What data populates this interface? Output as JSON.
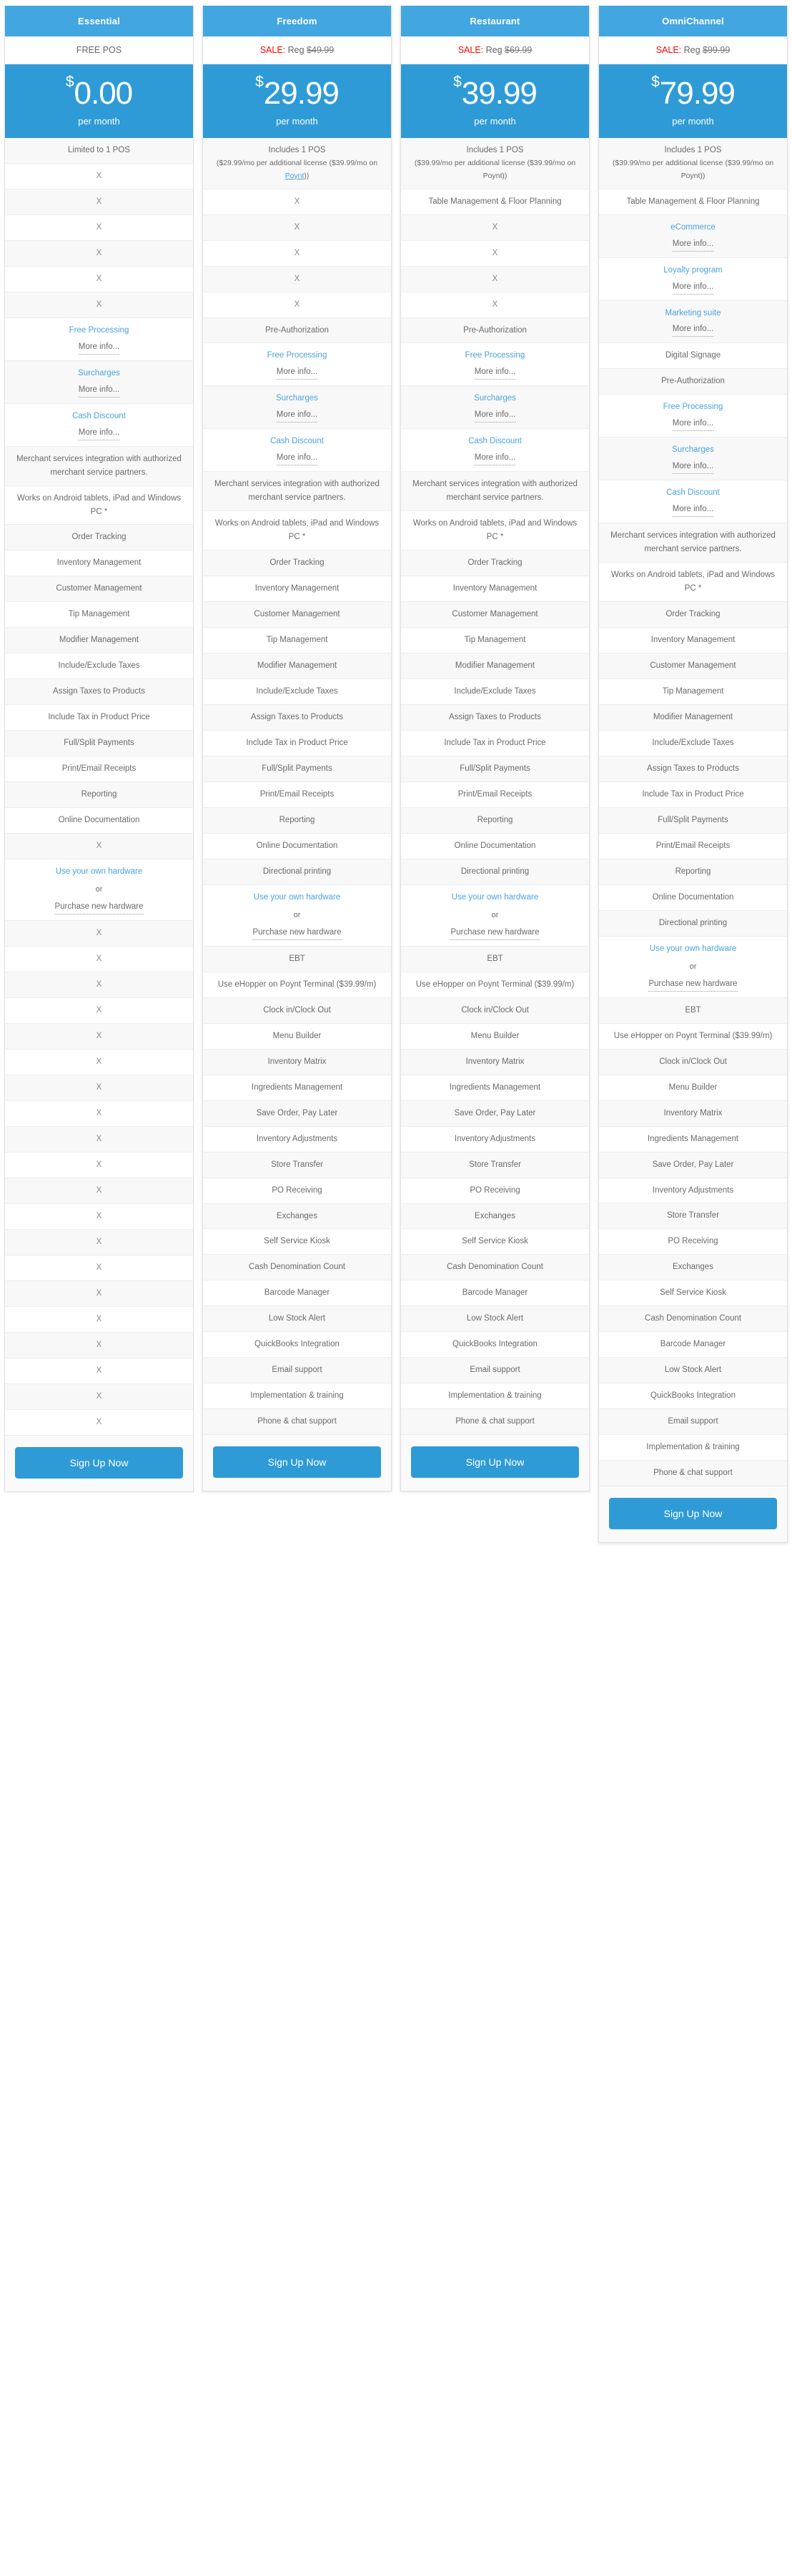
{
  "meta": {
    "accent_blue": "#2e9bd6",
    "header_blue": "#42a7e0",
    "link_blue": "#4aa3e0",
    "sale_red": "#ff0000",
    "text_gray": "#6b6b6b",
    "alt_row_bg": "#f8f8f8"
  },
  "labels": {
    "per_month": "per month",
    "more_info": "More info...",
    "or": "or",
    "signup": "Sign Up Now",
    "x": "X"
  },
  "plans": [
    {
      "name": "Essential",
      "sale_prefix": "",
      "sale_reg": "",
      "sale_price": "",
      "headline": "FREE POS",
      "is_sale": false,
      "currency": "$",
      "price": "0.00",
      "period": "per month",
      "signup": "Sign Up Now"
    },
    {
      "name": "Freedom",
      "sale_prefix": "SALE:",
      "sale_reg": "Reg",
      "sale_price": "$49.99",
      "headline": "",
      "is_sale": true,
      "currency": "$",
      "price": "29.99",
      "period": "per month",
      "signup": "Sign Up Now"
    },
    {
      "name": "Restaurant",
      "sale_prefix": "SALE:",
      "sale_reg": "Reg",
      "sale_price": "$69.99",
      "headline": "",
      "is_sale": true,
      "currency": "$",
      "price": "39.99",
      "period": "per month",
      "signup": "Sign Up Now"
    },
    {
      "name": "OmniChannel",
      "sale_prefix": "SALE:",
      "sale_reg": "Reg",
      "sale_price": "$99.99",
      "headline": "",
      "is_sale": true,
      "currency": "$",
      "price": "79.99",
      "period": "per month",
      "signup": "Sign Up Now"
    }
  ],
  "columns": {
    "essential": [
      {
        "t": "text",
        "v": "Limited to 1 POS"
      },
      {
        "t": "x",
        "v": "X"
      },
      {
        "t": "x",
        "v": "X"
      },
      {
        "t": "x",
        "v": "X"
      },
      {
        "t": "x",
        "v": "X"
      },
      {
        "t": "x",
        "v": "X"
      },
      {
        "t": "x",
        "v": "X"
      },
      {
        "t": "link",
        "v": "Free Processing",
        "more": "More info..."
      },
      {
        "t": "link",
        "v": "Surcharges",
        "more": "More info..."
      },
      {
        "t": "link",
        "v": "Cash Discount",
        "more": "More info..."
      },
      {
        "t": "text",
        "v": "Merchant services integration with authorized merchant service partners."
      },
      {
        "t": "text",
        "v": "Works on Android tablets, iPad and Windows PC *"
      },
      {
        "t": "text",
        "v": "Order Tracking"
      },
      {
        "t": "text",
        "v": "Inventory Management"
      },
      {
        "t": "text",
        "v": "Customer Management"
      },
      {
        "t": "text",
        "v": "Tip Management"
      },
      {
        "t": "text",
        "v": "Modifier Management"
      },
      {
        "t": "text",
        "v": "Include/Exclude Taxes"
      },
      {
        "t": "text",
        "v": "Assign Taxes to Products"
      },
      {
        "t": "text",
        "v": "Include Tax in Product Price"
      },
      {
        "t": "text",
        "v": "Full/Split Payments"
      },
      {
        "t": "text",
        "v": "Print/Email Receipts"
      },
      {
        "t": "text",
        "v": "Reporting"
      },
      {
        "t": "text",
        "v": "Online Documentation"
      },
      {
        "t": "x",
        "v": "X"
      },
      {
        "t": "hardware",
        "v": "Use your own hardware",
        "or": "or",
        "v2": "Purchase new hardware"
      },
      {
        "t": "x",
        "v": "X"
      },
      {
        "t": "x",
        "v": "X"
      },
      {
        "t": "x",
        "v": "X"
      },
      {
        "t": "x",
        "v": "X"
      },
      {
        "t": "x",
        "v": "X"
      },
      {
        "t": "x",
        "v": "X"
      },
      {
        "t": "x",
        "v": "X"
      },
      {
        "t": "x",
        "v": "X"
      },
      {
        "t": "x",
        "v": "X"
      },
      {
        "t": "x",
        "v": "X"
      },
      {
        "t": "x",
        "v": "X"
      },
      {
        "t": "x",
        "v": "X"
      },
      {
        "t": "x",
        "v": "X"
      },
      {
        "t": "x",
        "v": "X"
      },
      {
        "t": "x",
        "v": "X"
      },
      {
        "t": "x",
        "v": "X"
      },
      {
        "t": "x",
        "v": "X"
      },
      {
        "t": "x",
        "v": "X"
      },
      {
        "t": "x",
        "v": "X"
      },
      {
        "t": "x",
        "v": "X"
      }
    ],
    "freedom": [
      {
        "t": "pos",
        "v": "Includes 1 POS",
        "sub": "($29.99/mo per additional license ($39.99/mo on ",
        "link": "Poynt",
        "sub2": "))"
      },
      {
        "t": "x",
        "v": "X"
      },
      {
        "t": "x",
        "v": "X"
      },
      {
        "t": "x",
        "v": "X"
      },
      {
        "t": "x",
        "v": "X"
      },
      {
        "t": "x",
        "v": "X"
      },
      {
        "t": "text",
        "v": "Pre-Authorization"
      },
      {
        "t": "link",
        "v": "Free Processing",
        "more": "More info..."
      },
      {
        "t": "link",
        "v": "Surcharges",
        "more": "More info..."
      },
      {
        "t": "link",
        "v": "Cash Discount",
        "more": "More info..."
      },
      {
        "t": "text",
        "v": "Merchant services integration with authorized merchant service partners."
      },
      {
        "t": "text",
        "v": "Works on Android tablets, iPad and Windows PC *"
      },
      {
        "t": "text",
        "v": "Order Tracking"
      },
      {
        "t": "text",
        "v": "Inventory Management"
      },
      {
        "t": "text",
        "v": "Customer Management"
      },
      {
        "t": "text",
        "v": "Tip Management"
      },
      {
        "t": "text",
        "v": "Modifier Management"
      },
      {
        "t": "text",
        "v": "Include/Exclude Taxes"
      },
      {
        "t": "text",
        "v": "Assign Taxes to Products"
      },
      {
        "t": "text",
        "v": "Include Tax in Product Price"
      },
      {
        "t": "text",
        "v": "Full/Split Payments"
      },
      {
        "t": "text",
        "v": "Print/Email Receipts"
      },
      {
        "t": "text",
        "v": "Reporting"
      },
      {
        "t": "text",
        "v": "Online Documentation"
      },
      {
        "t": "text",
        "v": "Directional printing"
      },
      {
        "t": "hardware",
        "v": "Use your own hardware",
        "or": "or",
        "v2": "Purchase new hardware"
      },
      {
        "t": "text",
        "v": "EBT"
      },
      {
        "t": "text",
        "v": "Use eHopper on Poynt Terminal ($39.99/m)"
      },
      {
        "t": "text",
        "v": "Clock in/Clock Out"
      },
      {
        "t": "text",
        "v": "Menu Builder"
      },
      {
        "t": "text",
        "v": "Inventory Matrix"
      },
      {
        "t": "text",
        "v": "Ingredients Management"
      },
      {
        "t": "text",
        "v": "Save Order, Pay Later"
      },
      {
        "t": "text",
        "v": "Inventory Adjustments"
      },
      {
        "t": "text",
        "v": "Store Transfer"
      },
      {
        "t": "text",
        "v": "PO Receiving"
      },
      {
        "t": "text",
        "v": "Exchanges"
      },
      {
        "t": "text",
        "v": "Self Service Kiosk"
      },
      {
        "t": "text",
        "v": "Cash Denomination Count"
      },
      {
        "t": "text",
        "v": "Barcode Manager"
      },
      {
        "t": "text",
        "v": "Low Stock Alert"
      },
      {
        "t": "text",
        "v": "QuickBooks Integration"
      },
      {
        "t": "text",
        "v": "Email support"
      },
      {
        "t": "text",
        "v": "Implementation & training"
      },
      {
        "t": "text",
        "v": "Phone & chat support"
      }
    ],
    "restaurant": [
      {
        "t": "pos",
        "v": "Includes 1 POS",
        "sub": "($39.99/mo per additional license ($39.99/mo on Poynt))",
        "link": "",
        "sub2": ""
      },
      {
        "t": "text",
        "v": "Table Management & Floor Planning"
      },
      {
        "t": "x",
        "v": "X"
      },
      {
        "t": "x",
        "v": "X"
      },
      {
        "t": "x",
        "v": "X"
      },
      {
        "t": "x",
        "v": "X"
      },
      {
        "t": "text",
        "v": "Pre-Authorization"
      },
      {
        "t": "link",
        "v": "Free Processing",
        "more": "More info..."
      },
      {
        "t": "link",
        "v": "Surcharges",
        "more": "More info..."
      },
      {
        "t": "link",
        "v": "Cash Discount",
        "more": "More info..."
      },
      {
        "t": "text",
        "v": "Merchant services integration with authorized merchant service partners."
      },
      {
        "t": "text",
        "v": "Works on Android tablets, iPad and Windows PC *"
      },
      {
        "t": "text",
        "v": "Order Tracking"
      },
      {
        "t": "text",
        "v": "Inventory Management"
      },
      {
        "t": "text",
        "v": "Customer Management"
      },
      {
        "t": "text",
        "v": "Tip Management"
      },
      {
        "t": "text",
        "v": "Modifier Management"
      },
      {
        "t": "text",
        "v": "Include/Exclude Taxes"
      },
      {
        "t": "text",
        "v": "Assign Taxes to Products"
      },
      {
        "t": "text",
        "v": "Include Tax in Product Price"
      },
      {
        "t": "text",
        "v": "Full/Split Payments"
      },
      {
        "t": "text",
        "v": "Print/Email Receipts"
      },
      {
        "t": "text",
        "v": "Reporting"
      },
      {
        "t": "text",
        "v": "Online Documentation"
      },
      {
        "t": "text",
        "v": "Directional printing"
      },
      {
        "t": "hardware",
        "v": "Use your own hardware",
        "or": "or",
        "v2": "Purchase new hardware"
      },
      {
        "t": "text",
        "v": "EBT"
      },
      {
        "t": "text",
        "v": "Use eHopper on Poynt Terminal ($39.99/m)"
      },
      {
        "t": "text",
        "v": "Clock in/Clock Out"
      },
      {
        "t": "text",
        "v": "Menu Builder"
      },
      {
        "t": "text",
        "v": "Inventory Matrix"
      },
      {
        "t": "text",
        "v": "Ingredients Management"
      },
      {
        "t": "text",
        "v": "Save Order, Pay Later"
      },
      {
        "t": "text",
        "v": "Inventory Adjustments"
      },
      {
        "t": "text",
        "v": "Store Transfer"
      },
      {
        "t": "text",
        "v": "PO Receiving"
      },
      {
        "t": "text",
        "v": "Exchanges"
      },
      {
        "t": "text",
        "v": "Self Service Kiosk"
      },
      {
        "t": "text",
        "v": "Cash Denomination Count"
      },
      {
        "t": "text",
        "v": "Barcode Manager"
      },
      {
        "t": "text",
        "v": "Low Stock Alert"
      },
      {
        "t": "text",
        "v": "QuickBooks Integration"
      },
      {
        "t": "text",
        "v": "Email support"
      },
      {
        "t": "text",
        "v": "Implementation & training"
      },
      {
        "t": "text",
        "v": "Phone & chat support"
      }
    ],
    "omnichannel": [
      {
        "t": "pos",
        "v": "Includes 1 POS",
        "sub": "($39.99/mo per additional license ($39.99/mo on Poynt))",
        "link": "",
        "sub2": ""
      },
      {
        "t": "text",
        "v": "Table Management & Floor Planning"
      },
      {
        "t": "link",
        "v": "eCommerce",
        "more": "More info..."
      },
      {
        "t": "link",
        "v": "Loyalty program",
        "more": "More info..."
      },
      {
        "t": "link",
        "v": "Marketing suite",
        "more": "More info..."
      },
      {
        "t": "text",
        "v": "Digital Signage"
      },
      {
        "t": "text",
        "v": "Pre-Authorization"
      },
      {
        "t": "link",
        "v": "Free Processing",
        "more": "More info..."
      },
      {
        "t": "link",
        "v": "Surcharges",
        "more": "More info..."
      },
      {
        "t": "link",
        "v": "Cash Discount",
        "more": "More info..."
      },
      {
        "t": "text",
        "v": "Merchant services integration with authorized merchant service partners."
      },
      {
        "t": "text",
        "v": "Works on Android tablets, iPad and Windows PC *"
      },
      {
        "t": "text",
        "v": "Order Tracking"
      },
      {
        "t": "text",
        "v": "Inventory Management"
      },
      {
        "t": "text",
        "v": "Customer Management"
      },
      {
        "t": "text",
        "v": "Tip Management"
      },
      {
        "t": "text",
        "v": "Modifier Management"
      },
      {
        "t": "text",
        "v": "Include/Exclude Taxes"
      },
      {
        "t": "text",
        "v": "Assign Taxes to Products"
      },
      {
        "t": "text",
        "v": "Include Tax in Product Price"
      },
      {
        "t": "text",
        "v": "Full/Split Payments"
      },
      {
        "t": "text",
        "v": "Print/Email Receipts"
      },
      {
        "t": "text",
        "v": "Reporting"
      },
      {
        "t": "text",
        "v": "Online Documentation"
      },
      {
        "t": "text",
        "v": "Directional printing"
      },
      {
        "t": "hardware",
        "v": "Use your own hardware",
        "or": "or",
        "v2": "Purchase new hardware"
      },
      {
        "t": "text",
        "v": "EBT"
      },
      {
        "t": "text",
        "v": "Use eHopper on Poynt Terminal ($39.99/m)"
      },
      {
        "t": "text",
        "v": "Clock in/Clock Out"
      },
      {
        "t": "text",
        "v": "Menu Builder"
      },
      {
        "t": "text",
        "v": "Inventory Matrix"
      },
      {
        "t": "text",
        "v": "Ingredients Management"
      },
      {
        "t": "text",
        "v": "Save Order, Pay Later"
      },
      {
        "t": "text",
        "v": "Inventory Adjustments"
      },
      {
        "t": "text",
        "v": "Store Transfer"
      },
      {
        "t": "text",
        "v": "PO Receiving"
      },
      {
        "t": "text",
        "v": "Exchanges"
      },
      {
        "t": "text",
        "v": "Self Service Kiosk"
      },
      {
        "t": "text",
        "v": "Cash Denomination Count"
      },
      {
        "t": "text",
        "v": "Barcode Manager"
      },
      {
        "t": "text",
        "v": "Low Stock Alert"
      },
      {
        "t": "text",
        "v": "QuickBooks Integration"
      },
      {
        "t": "text",
        "v": "Email support"
      },
      {
        "t": "text",
        "v": "Implementation & training"
      },
      {
        "t": "text",
        "v": "Phone & chat support"
      }
    ]
  }
}
